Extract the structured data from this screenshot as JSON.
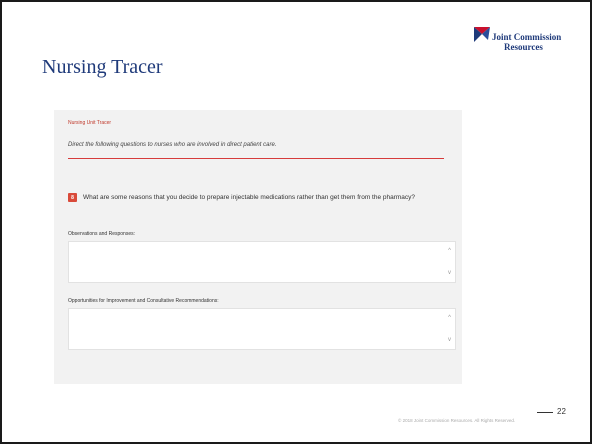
{
  "slide": {
    "title": "Nursing Tracer",
    "logo": {
      "line1": "Joint Commission",
      "line2": "Resources",
      "icon": "joint-commission-logo-icon"
    },
    "page_number": "22",
    "copyright": "© 2018 Joint Commission Resources. All Rights Reserved."
  },
  "form": {
    "header": "Nursing Unit Tracer",
    "instruction": "Direct the following questions to nurses who are involved in direct patient care.",
    "question": {
      "number": "8",
      "text": "What are some reasons that you decide to prepare injectable medications rather than get them from the pharmacy?"
    },
    "fields": [
      {
        "label": "Observations and Responses:",
        "value": ""
      },
      {
        "label": "Opportunities for Improvement and Consultative Recommendations:",
        "value": ""
      }
    ]
  },
  "colors": {
    "title": "#1f3a7a",
    "accent_red": "#d63b3b",
    "panel_bg": "#f2f2f2",
    "logo_red": "#c8102e",
    "logo_navy": "#1f3a7a"
  }
}
